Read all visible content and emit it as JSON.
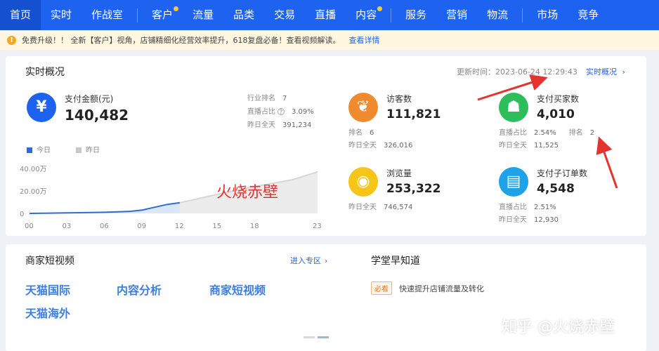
{
  "nav": {
    "items": [
      {
        "label": "首页",
        "active": true,
        "dot": false
      },
      {
        "label": "实时",
        "active": false,
        "dot": false
      },
      {
        "label": "作战室",
        "active": false,
        "dot": false
      },
      {
        "label": "客户",
        "active": false,
        "dot": true
      },
      {
        "label": "流量",
        "active": false,
        "dot": false
      },
      {
        "label": "品类",
        "active": false,
        "dot": false
      },
      {
        "label": "交易",
        "active": false,
        "dot": false
      },
      {
        "label": "直播",
        "active": false,
        "dot": false
      },
      {
        "label": "内容",
        "active": false,
        "dot": true
      },
      {
        "label": "服务",
        "active": false,
        "dot": false
      },
      {
        "label": "营销",
        "active": false,
        "dot": false
      },
      {
        "label": "物流",
        "active": false,
        "dot": false
      },
      {
        "label": "市场",
        "active": false,
        "dot": false
      },
      {
        "label": "竞争",
        "active": false,
        "dot": false
      }
    ]
  },
  "notice": {
    "text": "免费升级！！ 全新【客户】视角，店铺精细化经营效率提升，618复盘必备！查看视频解读。",
    "link": "查看详情"
  },
  "realtime": {
    "title": "实时概况",
    "update_label": "更新时间：2023-06-24 12:29:43",
    "overview_link": "实时概况",
    "pay": {
      "label": "支付金额(元)",
      "value": "140,482",
      "rank_label": "行业排名",
      "rank_value": "7",
      "live_label": "直播占比",
      "live_value": "3.09%",
      "yday_label": "昨日全天",
      "yday_value": "391,234",
      "icon": "yen-icon"
    },
    "legend": {
      "today": "今日",
      "yesterday": "昨日"
    },
    "colors": {
      "today": "#2f6bd0",
      "yesterday": "#c8c8c8",
      "accent": "#1e63f0"
    },
    "metrics": [
      {
        "key": "visitors",
        "label": "访客数",
        "value": "111,821",
        "icon": "footprint-icon",
        "color": "#f08a2f",
        "lines": [
          {
            "k": "排名",
            "v": "6"
          },
          {
            "k": "昨日全天",
            "v": "326,016"
          }
        ]
      },
      {
        "key": "buyers",
        "label": "支付买家数",
        "value": "4,010",
        "icon": "people-icon",
        "color": "#2dbd5b",
        "lines": [
          {
            "k": "直播占比",
            "v": "2.54%",
            "k2": "排名",
            "v2": "2"
          },
          {
            "k": "昨日全天",
            "v": "11,525"
          }
        ]
      },
      {
        "key": "views",
        "label": "浏览量",
        "value": "253,322",
        "icon": "eye-icon",
        "color": "#f5c518",
        "lines": [
          {
            "k": "昨日全天",
            "v": "746,574"
          }
        ]
      },
      {
        "key": "suborders",
        "label": "支付子订单数",
        "value": "4,548",
        "icon": "list-icon",
        "color": "#1fa3e8",
        "lines": [
          {
            "k": "直播占比",
            "v": "2.51%"
          },
          {
            "k": "昨日全天",
            "v": "12,930"
          }
        ]
      }
    ]
  },
  "chart_data": {
    "type": "area",
    "x_ticks": [
      "00",
      "03",
      "06",
      "09",
      "12",
      "15",
      "18",
      "23"
    ],
    "y_ticks": [
      "40.00万",
      "20.00万",
      "0"
    ],
    "ylim": [
      0,
      400000
    ],
    "series": [
      {
        "name": "今日",
        "x": [
          0,
          3,
          6,
          8,
          9,
          10,
          11,
          12
        ],
        "values": [
          0,
          5000,
          10000,
          18000,
          30000,
          55000,
          80000,
          95000
        ]
      },
      {
        "name": "昨日",
        "x": [
          12,
          15,
          18,
          21,
          23
        ],
        "values": [
          95000,
          170000,
          240000,
          300000,
          370000
        ]
      }
    ]
  },
  "overlay": {
    "watermark": "火烧赤壁",
    "zhihu": "知乎 @火烧赤壁"
  },
  "shortvideo": {
    "title": "商家短视频",
    "enter_link": "进入专区",
    "tiles": [
      "天猫国际",
      "内容分析",
      "商家短视频",
      "天猫海外"
    ]
  },
  "school": {
    "title": "学堂早知道",
    "badge": "必看",
    "item": "快速提升店铺流量及转化"
  }
}
